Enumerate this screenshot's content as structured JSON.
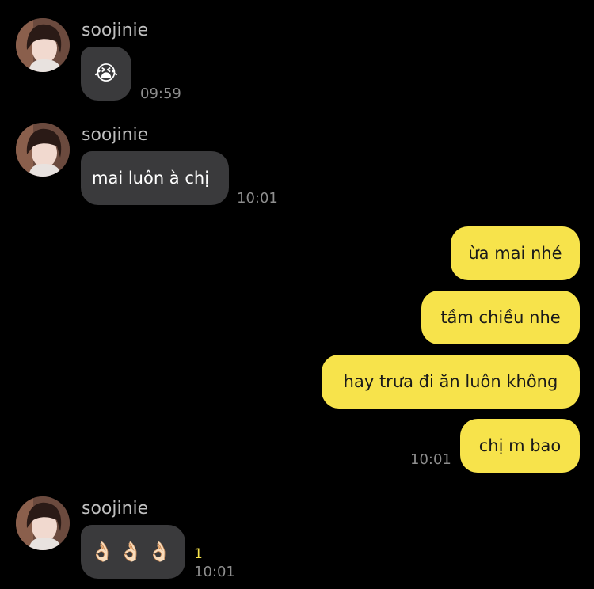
{
  "colors": {
    "background": "#000000",
    "incoming_bubble": "#3a3a3c",
    "outgoing_bubble": "#f7e34b",
    "timestamp": "#8e8e8e",
    "unread_count": "#f7e34b"
  },
  "messages": [
    {
      "sender": "soojinie",
      "avatar_icon": "profile-photo",
      "text": "😭",
      "time": "09:59"
    },
    {
      "sender": "soojinie",
      "avatar_icon": "profile-photo",
      "text": "mai luôn à chị",
      "time": "10:01"
    },
    {
      "outgoing": [
        "ừa mai nhé",
        "tầm chiều nhe",
        "hay trưa đi ăn luôn không",
        "chị m bao"
      ],
      "time": "10:01"
    },
    {
      "sender": "soojinie",
      "avatar_icon": "profile-photo",
      "text": "👌🏻👌🏻👌🏻",
      "unread_count": "1",
      "time": "10:01"
    }
  ]
}
